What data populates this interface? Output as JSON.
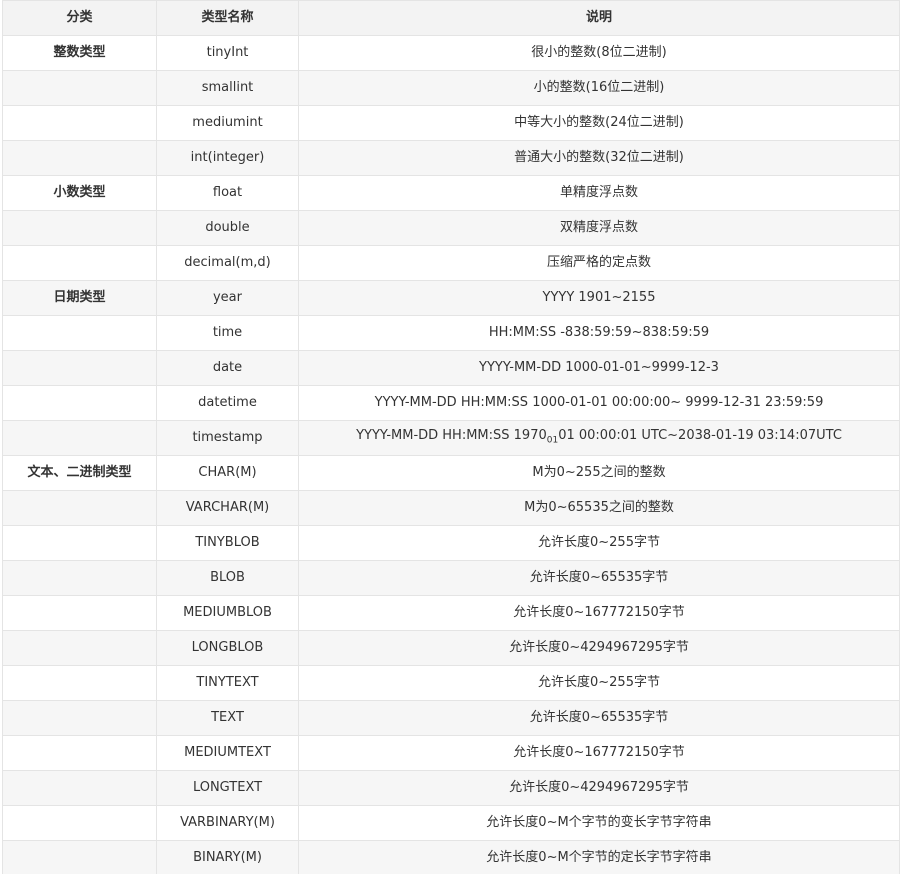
{
  "table": {
    "headers": [
      "分类",
      "类型名称",
      "说明"
    ],
    "rows": [
      {
        "category": "整数类型",
        "type": "tinyInt",
        "desc": "很小的整数(8位二进制)"
      },
      {
        "category": "",
        "type": "smallint",
        "desc": "小的整数(16位二进制)"
      },
      {
        "category": "",
        "type": "mediumint",
        "desc": "中等大小的整数(24位二进制)"
      },
      {
        "category": "",
        "type": "int(integer)",
        "desc": "普通大小的整数(32位二进制)"
      },
      {
        "category": "小数类型",
        "type": "float",
        "desc": "单精度浮点数"
      },
      {
        "category": "",
        "type": "double",
        "desc": "双精度浮点数"
      },
      {
        "category": "",
        "type": "decimal(m,d)",
        "desc": "压缩严格的定点数"
      },
      {
        "category": "日期类型",
        "type": "year",
        "desc": "YYYY 1901~2155"
      },
      {
        "category": "",
        "type": "time",
        "desc": "HH:MM:SS -838:59:59~838:59:59"
      },
      {
        "category": "",
        "type": "date",
        "desc": "YYYY-MM-DD 1000-01-01~9999-12-3"
      },
      {
        "category": "",
        "type": "datetime",
        "desc": "YYYY-MM-DD HH:MM:SS 1000-01-01 00:00:00~ 9999-12-31 23:59:59"
      },
      {
        "category": "",
        "type": "timestamp",
        "desc": "YYYY-MM-DD HH:MM:SS 1970",
        "desc_sub": "01",
        "desc_tail": "01 00:00:01 UTC~2038-01-19 03:14:07UTC"
      },
      {
        "category": "文本、二进制类型",
        "type": "CHAR(M)",
        "desc": "M为0~255之间的整数"
      },
      {
        "category": "",
        "type": "VARCHAR(M)",
        "desc": "M为0~65535之间的整数"
      },
      {
        "category": "",
        "type": "TINYBLOB",
        "desc": "允许长度0~255字节"
      },
      {
        "category": "",
        "type": "BLOB",
        "desc": "允许长度0~65535字节"
      },
      {
        "category": "",
        "type": "MEDIUMBLOB",
        "desc": "允许长度0~167772150字节"
      },
      {
        "category": "",
        "type": "LONGBLOB",
        "desc": "允许长度0~4294967295字节"
      },
      {
        "category": "",
        "type": "TINYTEXT",
        "desc": "允许长度0~255字节"
      },
      {
        "category": "",
        "type": "TEXT",
        "desc": "允许长度0~65535字节"
      },
      {
        "category": "",
        "type": "MEDIUMTEXT",
        "desc": "允许长度0~167772150字节"
      },
      {
        "category": "",
        "type": "LONGTEXT",
        "desc": "允许长度0~4294967295字节"
      },
      {
        "category": "",
        "type": "VARBINARY(M)",
        "desc": "允许长度0~M个字节的变长字节字符串"
      },
      {
        "category": "",
        "type": "BINARY(M)",
        "desc": "允许长度0~M个字节的定长字节字符串"
      }
    ]
  }
}
